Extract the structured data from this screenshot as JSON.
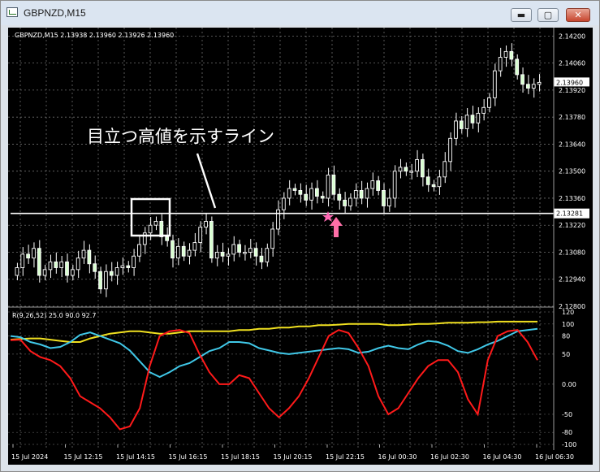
{
  "window": {
    "title": "GBPNZD,M15",
    "buttons": {
      "minimize": "▬",
      "maximize": "▢",
      "close": "✕"
    }
  },
  "main_chart": {
    "info": "GBPNZD,M15  2.13938 2.13960 2.13926 2.13960",
    "price_labels": [
      "2.14200",
      "2.14060",
      "2.13920",
      "2.13780",
      "2.13640",
      "2.13500",
      "2.13360",
      "2.13220",
      "2.13080",
      "2.12940",
      "2.12800"
    ],
    "current_price": "2.13960",
    "hline_price": "2.13281",
    "annotation": "目立つ高値を示すライン"
  },
  "indicator": {
    "label": "R(9,26,52) 25.0 90.0 92.7",
    "levels": [
      "120",
      "100",
      "80",
      "50",
      "0.00",
      "-50",
      "-80",
      "-100"
    ],
    "colors": {
      "fast": "#ff1a1a",
      "mid": "#40c8e8",
      "slow": "#f0e020"
    }
  },
  "time_labels": [
    "15 Jul 2024",
    "15 Jul 12:15",
    "15 Jul 14:15",
    "15 Jul 16:15",
    "15 Jul 18:15",
    "15 Jul 20:15",
    "15 Jul 22:15",
    "16 Jul 00:30",
    "16 Jul 02:30",
    "16 Jul 04:30",
    "16 Jul 06:30"
  ],
  "chart_data": {
    "type": "candlestick",
    "symbol": "GBPNZD",
    "timeframe": "M15",
    "ylim": [
      2.128,
      2.1421
    ],
    "hline": 2.13281,
    "close_series": [
      2.13,
      2.1307,
      2.1305,
      2.131,
      2.1296,
      2.1299,
      2.1303,
      2.13,
      2.1303,
      2.1296,
      2.1299,
      2.1305,
      2.1309,
      2.1302,
      2.1298,
      2.1289,
      2.1298,
      2.1296,
      2.13,
      2.1301,
      2.13,
      2.1306,
      2.1312,
      2.1318,
      2.1322,
      2.1324,
      2.1316,
      2.1314,
      2.1305,
      2.1311,
      2.1306,
      2.1309,
      2.1313,
      2.1321,
      2.1324,
      2.1305,
      2.1308,
      2.1306,
      2.1307,
      2.1312,
      2.1308,
      2.1308,
      2.131,
      2.1306,
      2.1303,
      2.131,
      2.132,
      2.133,
      2.1336,
      2.1341,
      2.134,
      2.1338,
      2.1335,
      2.1341,
      2.1337,
      2.1336,
      2.1348,
      2.1338,
      2.1335,
      2.1332,
      2.1336,
      2.134,
      2.1336,
      2.1341,
      2.1345,
      2.134,
      2.1332,
      2.1336,
      2.135,
      2.1352,
      2.135,
      2.135,
      2.1356,
      2.1347,
      2.1343,
      2.1342,
      2.1347,
      2.1355,
      2.1367,
      2.1376,
      2.1372,
      2.1379,
      2.1375,
      2.138,
      2.1383,
      2.1388,
      2.1402,
      2.1409,
      2.1412,
      2.1408,
      2.14,
      2.1395,
      2.1393,
      2.1395,
      2.1396
    ],
    "oscillator": {
      "scale": [
        -100,
        120
      ],
      "fast": [
        73,
        74,
        55,
        45,
        40,
        30,
        10,
        -20,
        -30,
        -40,
        -55,
        -75,
        -70,
        -40,
        30,
        80,
        88,
        90,
        85,
        50,
        20,
        0,
        0,
        15,
        10,
        -15,
        -40,
        -55,
        -40,
        -20,
        10,
        45,
        80,
        90,
        85,
        60,
        30,
        -20,
        -50,
        -40,
        -15,
        10,
        30,
        40,
        40,
        20,
        -25,
        -50,
        40,
        80,
        88,
        90,
        70,
        40
      ],
      "mid": [
        80,
        78,
        70,
        66,
        60,
        62,
        70,
        82,
        86,
        80,
        74,
        68,
        56,
        38,
        20,
        12,
        20,
        30,
        35,
        45,
        55,
        60,
        70,
        70,
        68,
        60,
        56,
        52,
        50,
        52,
        54,
        56,
        58,
        60,
        58,
        52,
        54,
        60,
        64,
        60,
        58,
        66,
        72,
        70,
        64,
        55,
        52,
        58,
        66,
        72,
        80,
        88,
        90,
        92
      ],
      "slow": [
        74,
        75,
        76,
        76,
        74,
        72,
        70,
        70,
        76,
        80,
        84,
        86,
        88,
        88,
        86,
        84,
        84,
        86,
        88,
        88,
        88,
        88,
        88,
        90,
        90,
        92,
        92,
        94,
        94,
        96,
        96,
        98,
        98,
        99,
        100,
        100,
        100,
        100,
        98,
        98,
        99,
        100,
        100,
        101,
        102,
        102,
        102,
        103,
        103,
        104,
        104,
        104,
        104,
        104
      ]
    }
  }
}
